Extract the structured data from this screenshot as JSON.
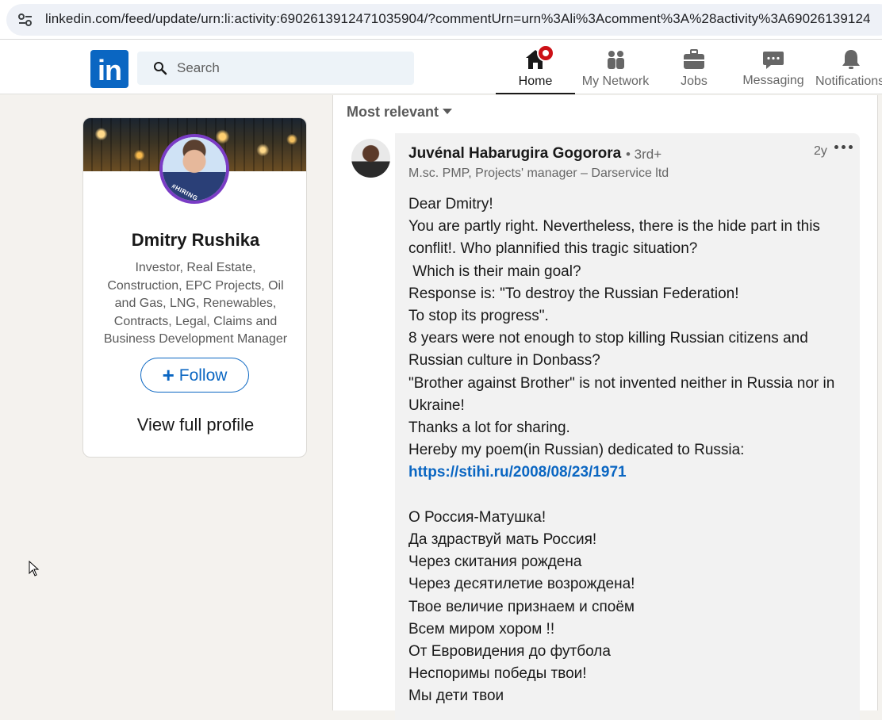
{
  "browser": {
    "url": "linkedin.com/feed/update/urn:li:activity:6902613912471035904/?commentUrn=urn%3Ali%3Acomment%3A%28activity%3A69026139124"
  },
  "header": {
    "logo": "in",
    "search_placeholder": "Search",
    "nav": {
      "home": "Home",
      "network": "My Network",
      "jobs": "Jobs",
      "messaging": "Messaging",
      "notifications": "Notifications"
    }
  },
  "profile": {
    "name": "Dmitry Rushika",
    "headline": "Investor, Real Estate, Construction, EPC Projects, Oil and Gas, LNG, Renewables, Contracts, Legal, Claims and Business Development Manager",
    "hiring_badge": "#HIRING",
    "follow_label": "Follow",
    "view_profile_label": "View full profile"
  },
  "feed": {
    "sort_label": "Most relevant"
  },
  "comment": {
    "author": "Juvénal Habarugira Gogorora",
    "degree": "• 3rd+",
    "time": "2y",
    "subtitle": "M.sc. PMP, Projects' manager – Darservice ltd",
    "body_before_link": "Dear Dmitry!\nYou are partly right. Nevertheless, there is the hide part in this conflit!. Who plannified this tragic situation?\n Which is their main goal?\nResponse is: \"To destroy the Russian Federation!\nTo stop its progress\".\n8 years were not enough to stop killing Russian citizens and Russian culture in Donbass?\n\"Brother against Brother\" is not invented neither in Russia nor in Ukraine!\nThanks a lot for sharing.\nHereby my poem(in Russian) dedicated to Russia:\n",
    "link": "https://stihi.ru/2008/08/23/1971",
    "body_after_link": "\n\nО Россия-Матушка!\nДа здраствуй мать Россия!\nЧерез скитания рождена\nЧерез десятилетие возрождена!\nТвое величие признаем и споём\nВсем миром хором !!\nОт Евровидения до футбола\nНеспоримы победы твои!\nМы дети твои"
  }
}
